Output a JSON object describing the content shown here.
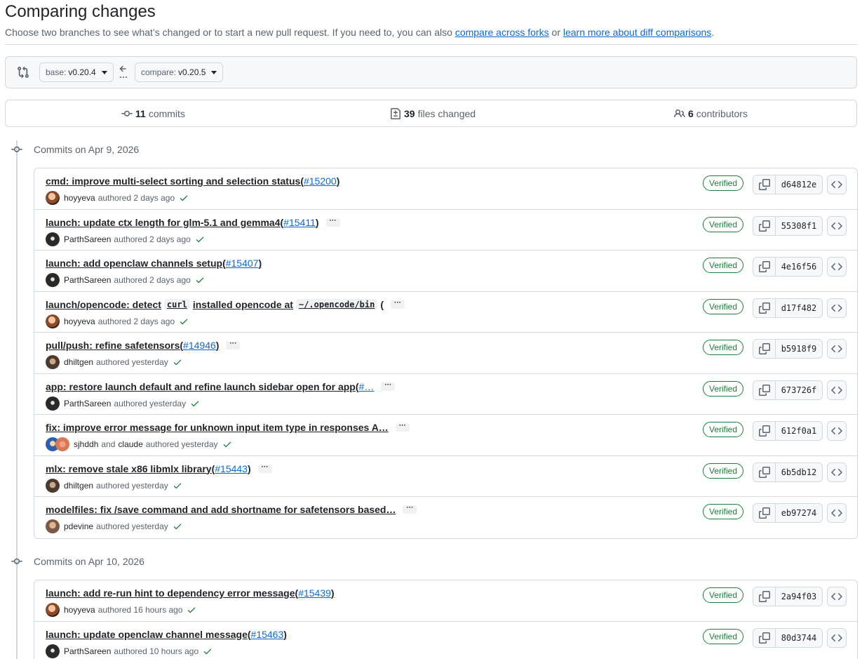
{
  "header": {
    "title": "Comparing changes",
    "subtitle_prefix": "Choose two branches to see what’s changed or to start a new pull request. If you need to, you can also ",
    "link_forks": "compare across forks",
    "subtitle_mid": " or ",
    "link_learn": "learn more about diff comparisons",
    "subtitle_suffix": "."
  },
  "range": {
    "base_label": "base:",
    "base_value": "v0.20.4",
    "compare_label": "compare:",
    "compare_value": "v0.20.5"
  },
  "summary": {
    "commits_count": "11",
    "commits_label": "commits",
    "files_count": "39",
    "files_label": "files changed",
    "contributors_count": "6",
    "contributors_label": "contributors"
  },
  "groups": [
    {
      "title": "Commits on Apr 9, 2026",
      "commits": [
        {
          "msg": "cmd: improve multi-select sorting and selection status ",
          "open": "(",
          "pr": "#15200",
          "close": ")",
          "more": false,
          "author": "hoyyeva",
          "coauthor": "",
          "time": "authored 2 days ago",
          "sha": "d64812e",
          "verified": "Verified",
          "avatar": "hoyyeva"
        },
        {
          "msg": "launch: update ctx length for glm-5.1 and gemma4 ",
          "open": "(",
          "pr": "#15411",
          "close": ")",
          "more": true,
          "author": "ParthSareen",
          "coauthor": "",
          "time": "authored 2 days ago",
          "sha": "55308f1",
          "verified": "Verified",
          "avatar": "parth"
        },
        {
          "msg": "launch: add openclaw channels setup ",
          "open": "(",
          "pr": "#15407",
          "close": ")",
          "more": false,
          "author": "ParthSareen",
          "coauthor": "",
          "time": "authored 2 days ago",
          "sha": "4e16f56",
          "verified": "Verified",
          "avatar": "parth"
        },
        {
          "msg": "",
          "open": "",
          "pr": "",
          "close": "",
          "more": true,
          "author": "hoyyeva",
          "coauthor": "",
          "time": "authored 2 days ago",
          "sha": "d17f482",
          "verified": "Verified",
          "avatar": "hoyyeva",
          "custom": "opencode"
        },
        {
          "msg": "pull/push: refine safetensors ",
          "open": "(",
          "pr": "#14946",
          "close": ")",
          "more": true,
          "author": "dhiltgen",
          "coauthor": "",
          "time": "authored yesterday",
          "sha": "b5918f9",
          "verified": "Verified",
          "avatar": "dhiltgen"
        },
        {
          "msg": "app: restore launch default and refine launch sidebar open for app ",
          "open": "(",
          "pr": "#…",
          "close": "",
          "more": true,
          "author": "ParthSareen",
          "coauthor": "",
          "time": "authored yesterday",
          "sha": "673726f",
          "verified": "Verified",
          "avatar": "parth"
        },
        {
          "msg": "fix: improve error message for unknown input item type in responses A…",
          "open": "",
          "pr": "",
          "close": "",
          "more": true,
          "author": "sjhddh",
          "coauthor": "claude",
          "time": "authored yesterday",
          "sha": "612f0a1",
          "verified": "Verified",
          "avatar": "sjhddh"
        },
        {
          "msg": "mlx: remove stale x86 libmlx library ",
          "open": "(",
          "pr": "#15443",
          "close": ")",
          "more": true,
          "author": "dhiltgen",
          "coauthor": "",
          "time": "authored yesterday",
          "sha": "6b5db12",
          "verified": "Verified",
          "avatar": "dhiltgen"
        },
        {
          "msg": "modelfiles: fix /save command and add shortname for safetensors based…",
          "open": "",
          "pr": "",
          "close": "",
          "more": true,
          "author": "pdevine",
          "coauthor": "",
          "time": "authored yesterday",
          "sha": "eb97274",
          "verified": "Verified",
          "avatar": "pdevine"
        }
      ]
    },
    {
      "title": "Commits on Apr 10, 2026",
      "commits": [
        {
          "msg": "launch: add re-run hint to dependency error message ",
          "open": "(",
          "pr": "#15439",
          "close": ")",
          "more": false,
          "author": "hoyyeva",
          "coauthor": "",
          "time": "authored 16 hours ago",
          "sha": "2a94f03",
          "verified": "Verified",
          "avatar": "hoyyeva"
        },
        {
          "msg": "launch: update openclaw channel message ",
          "open": "(",
          "pr": "#15463",
          "close": ")",
          "more": false,
          "author": "ParthSareen",
          "coauthor": "",
          "time": "authored 10 hours ago",
          "sha": "80d3744",
          "verified": "Verified",
          "avatar": "parth"
        }
      ]
    }
  ],
  "opencode_commit": {
    "pre": "launch/opencode: detect ",
    "code1": "curl",
    "mid": " installed opencode at ",
    "code2": "~/.opencode/bin",
    "post": " ("
  },
  "and_label": "and",
  "colors": {
    "link": "#0969da",
    "verified": "#1a7f37",
    "border": "#d1d9e0",
    "muted": "#59636e"
  }
}
